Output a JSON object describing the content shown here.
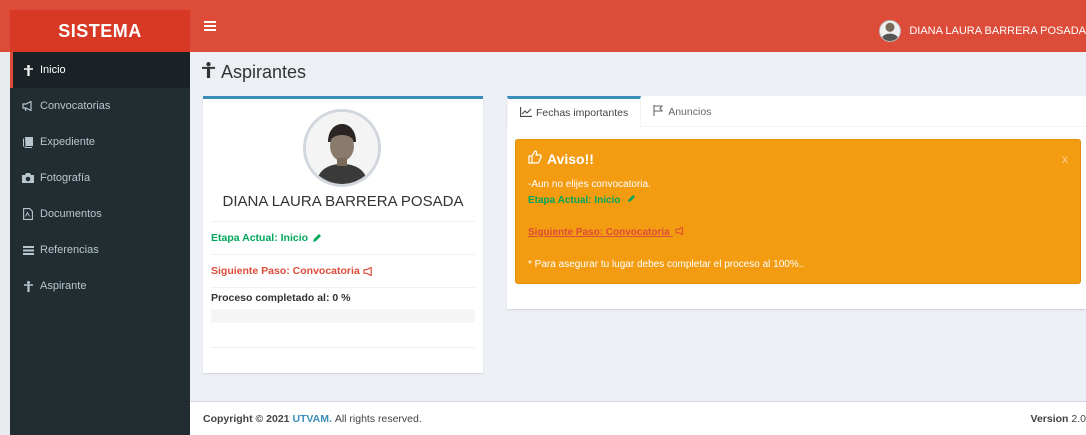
{
  "header": {
    "logo": "SISTEMA",
    "menu_icon": "hamburger-icon",
    "user_name": "DIANA LAURA BARRERA POSADA"
  },
  "sidebar": {
    "items": [
      {
        "label": "Inicio",
        "icon": "figure-icon",
        "active": true
      },
      {
        "label": "Convocatorias",
        "icon": "megaphone-icon"
      },
      {
        "label": "Expediente",
        "icon": "book-icon"
      },
      {
        "label": "Fotografía",
        "icon": "camera-icon"
      },
      {
        "label": "Documentos",
        "icon": "pdf-file-icon"
      },
      {
        "label": "Referencias",
        "icon": "list-icon"
      },
      {
        "label": "Aspirante",
        "icon": "figure-icon"
      }
    ]
  },
  "page": {
    "title": "Aspirantes"
  },
  "profile": {
    "name": "DIANA LAURA BARRERA POSADA",
    "stage": "Etapa Actual: Inicio",
    "next_step": "Siguiente Paso: Convocatoria",
    "progress_label": "Proceso completado al: 0 %",
    "progress": 0
  },
  "tabs": [
    {
      "label": "Fechas importantes",
      "icon": "line-chart-icon",
      "active": true
    },
    {
      "label": "Anuncios",
      "icon": "flag-icon"
    }
  ],
  "alert": {
    "title": "Aviso!!",
    "close": "x",
    "message": "-Aun no elijes convocatoria.",
    "stage": "Etapa Actual: Inicio",
    "next_step": "Siguiente Paso: Convocatoria",
    "note": "* Para asegurar tu lugar debes completar el proceso al 100%.."
  },
  "footer": {
    "copyright": "Copyright © 2021",
    "brand": "UTVAM.",
    "rights": "All rights reserved.",
    "version_label": "Version",
    "version_value": "2.0"
  },
  "colors": {
    "header": "#dd4b39",
    "sidebar": "#222d32",
    "accent": "#3c8dbc",
    "warning": "#f39c12",
    "success": "#00a65a"
  }
}
